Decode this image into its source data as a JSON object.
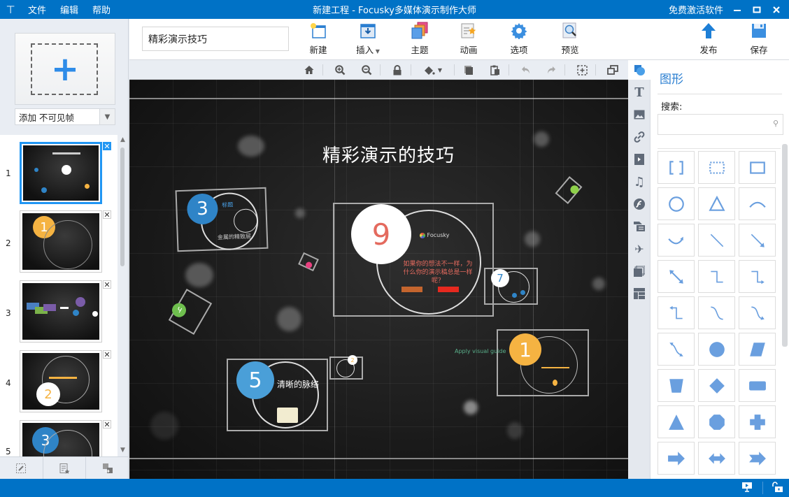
{
  "titlebar": {
    "app_icon": "presentation-icon",
    "menus": [
      "文件",
      "编辑",
      "帮助"
    ],
    "title": "新建工程 - Focusky多媒体演示制作大师",
    "activate": "免费激活软件",
    "minimize": "–",
    "maximize": "□",
    "close": "✕"
  },
  "left_panel": {
    "add_frame_icon": "plus-icon",
    "add_select_value": "添加 不可见帧",
    "frames": [
      {
        "number": "1",
        "selected": true,
        "badge": "",
        "badge_color": ""
      },
      {
        "number": "2",
        "selected": false,
        "badge": "1",
        "badge_color": "#f5b342"
      },
      {
        "number": "3",
        "selected": false,
        "badge": "",
        "badge_color": ""
      },
      {
        "number": "4",
        "selected": false,
        "badge": "2",
        "badge_color": "#ffffff"
      },
      {
        "number": "5",
        "selected": false,
        "badge": "3",
        "badge_color": "#2f84c7"
      }
    ],
    "close_glyph": "✕",
    "bottom_tools": [
      "edit-frame-icon",
      "frame-animation-icon",
      "swap-frame-icon"
    ]
  },
  "toolbar": {
    "project_name": "精彩演示技巧",
    "buttons": [
      {
        "id": "new",
        "label": "新建",
        "icon": "new-file-icon"
      },
      {
        "id": "insert",
        "label": "插入",
        "icon": "insert-icon",
        "has_dropdown": true
      },
      {
        "id": "theme",
        "label": "主题",
        "icon": "theme-icon"
      },
      {
        "id": "animation",
        "label": "动画",
        "icon": "animation-icon"
      },
      {
        "id": "options",
        "label": "选项",
        "icon": "gear-icon"
      },
      {
        "id": "preview",
        "label": "预览",
        "icon": "preview-icon"
      },
      {
        "id": "publish",
        "label": "发布",
        "icon": "upload-arrow-icon"
      },
      {
        "id": "save",
        "label": "保存",
        "icon": "save-icon"
      }
    ]
  },
  "subtoolbar": {
    "tools": [
      "home-icon",
      "zoom-in-icon",
      "zoom-out-icon",
      "lock-icon",
      "fill-bucket-icon",
      "copy-icon",
      "paste-icon",
      "undo-icon",
      "redo-icon",
      "fit-frame-icon",
      "window-restore-icon"
    ]
  },
  "canvas": {
    "title": "精彩演示的技巧",
    "nodes": {
      "n3": {
        "number": "3",
        "label": "标题",
        "caption": "金属的精致层"
      },
      "n9": {
        "number": "9",
        "brand": "Focusky",
        "text": "如果你的想法不一样，为什么你的演示稿总是一样呢？"
      },
      "n7": {
        "number": "7"
      },
      "n5": {
        "number": "5",
        "title": "清晰的脉络"
      },
      "n1": {
        "number": "1"
      },
      "n2": {
        "number": "2"
      },
      "apply_text": "Apply visual guide"
    },
    "colors": {
      "blue": "#2f84c7",
      "orange": "#f5b342",
      "red_text": "#e46a5e",
      "green": "#6fbf4e",
      "pink": "#e8407f"
    }
  },
  "right_sidebar": {
    "tabs": [
      "shape-icon",
      "text-icon",
      "image-icon",
      "link-icon",
      "video-icon",
      "music-icon",
      "flash-icon",
      "smartart-icon",
      "plane-icon",
      "layers-icon",
      "layout-icon"
    ],
    "panel_title": "图形",
    "search_label": "搜索:",
    "search_value": "",
    "shapes": [
      "bracket",
      "dotted-rect",
      "rect",
      "circle-outline",
      "triangle-outline",
      "arc",
      "curved-arrow",
      "line",
      "arrow-line",
      "double-arrow-line",
      "elbow-line",
      "elbow-arrow",
      "elbow-arrow-up",
      "s-curve",
      "s-curve-arrow",
      "double-s-arrow",
      "circle-filled",
      "parallelogram",
      "trapezoid",
      "diamond",
      "rounded-rect",
      "triangle-filled",
      "octagon",
      "cross",
      "right-arrow",
      "left-right-arrow",
      "chevron-arrow"
    ]
  },
  "statusbar": {
    "icons": [
      "presentation-mode-icon",
      "unlock-icon"
    ]
  }
}
